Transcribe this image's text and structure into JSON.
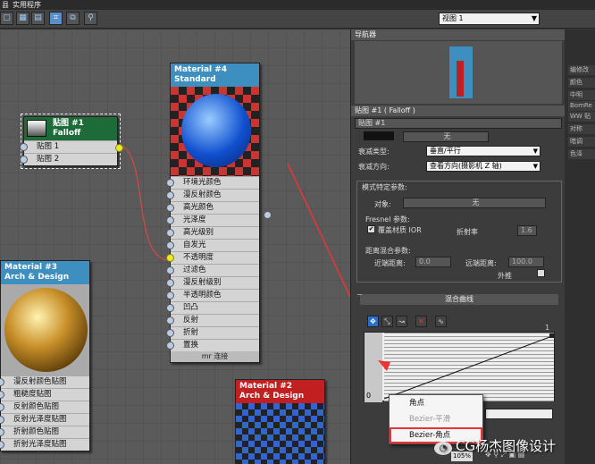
{
  "menubar": {
    "item1": "县",
    "item2": "实用程序"
  },
  "toolbar": {
    "view_select": "视图 1"
  },
  "navigator": {
    "title": "导航器"
  },
  "nodes": {
    "falloff": {
      "title": "贴图 #1",
      "subtitle": "Falloff",
      "slots": [
        "贴图 1",
        "贴图 2"
      ]
    },
    "material4": {
      "title": "Material #4",
      "subtitle": "Standard",
      "slots": [
        "环境光颜色",
        "漫反射颜色",
        "高光颜色",
        "光泽度",
        "高光级别",
        "自发光",
        "不透明度",
        "过滤色",
        "漫反射级别",
        "半透明颜色",
        "凹凸",
        "反射",
        "折射",
        "置换"
      ],
      "footer": "mr 连接"
    },
    "material3": {
      "title": "Material #3",
      "subtitle": "Arch & Design",
      "slots": [
        "漫反射颜色贴图",
        "粗糙度贴图",
        "反射颜色贴图",
        "反射光泽度贴图",
        "折射颜色贴图",
        "折射光泽度贴图"
      ]
    },
    "material2": {
      "title": "Material #2",
      "subtitle": "Arch & Design"
    }
  },
  "panel": {
    "title": "贴图 #1 ( Falloff )",
    "name_field": "贴图 #1",
    "none_label": "无",
    "falloff_type_label": "衰减类型:",
    "falloff_type_value": "垂直/平行",
    "falloff_dir_label": "衰减方向:",
    "falloff_dir_value": "查看方向(摄影机 Z 轴)",
    "mode_group_title": "模式特定参数:",
    "object_label": "对象:",
    "object_value": "无",
    "fresnel_group": "Fresnel 参数:",
    "override_ior_label": "覆盖材质 IOR",
    "ior_label": "折射率",
    "ior_value": "1.6",
    "distance_group": "距离混合参数:",
    "near_label": "近端距离:",
    "near_value": "0.0",
    "far_label": "远端距离:",
    "far_value": "100.0",
    "extrapolate_label": "外推",
    "curve_title": "混合曲线",
    "curve_zero": "0",
    "curve_one": "1"
  },
  "context_menu": {
    "items": [
      "角点",
      "Bezier-平滑",
      "Bezier-角点"
    ],
    "disabled_index": 1
  },
  "far_right": {
    "items": [
      "编修改",
      "颜色",
      "中明",
      "BomRe",
      "WW 贴",
      "对称",
      "暗调",
      "色泽"
    ]
  },
  "statusbar": {
    "zoom": "105%"
  },
  "watermark": {
    "text": "CG杨杰图像设计"
  },
  "colors": {
    "falloff_header": "#1e6b3a",
    "material_header": "#3d8fc0",
    "material2_header": "#c02020",
    "wire": "#d44",
    "selected_outline": "#e33"
  }
}
